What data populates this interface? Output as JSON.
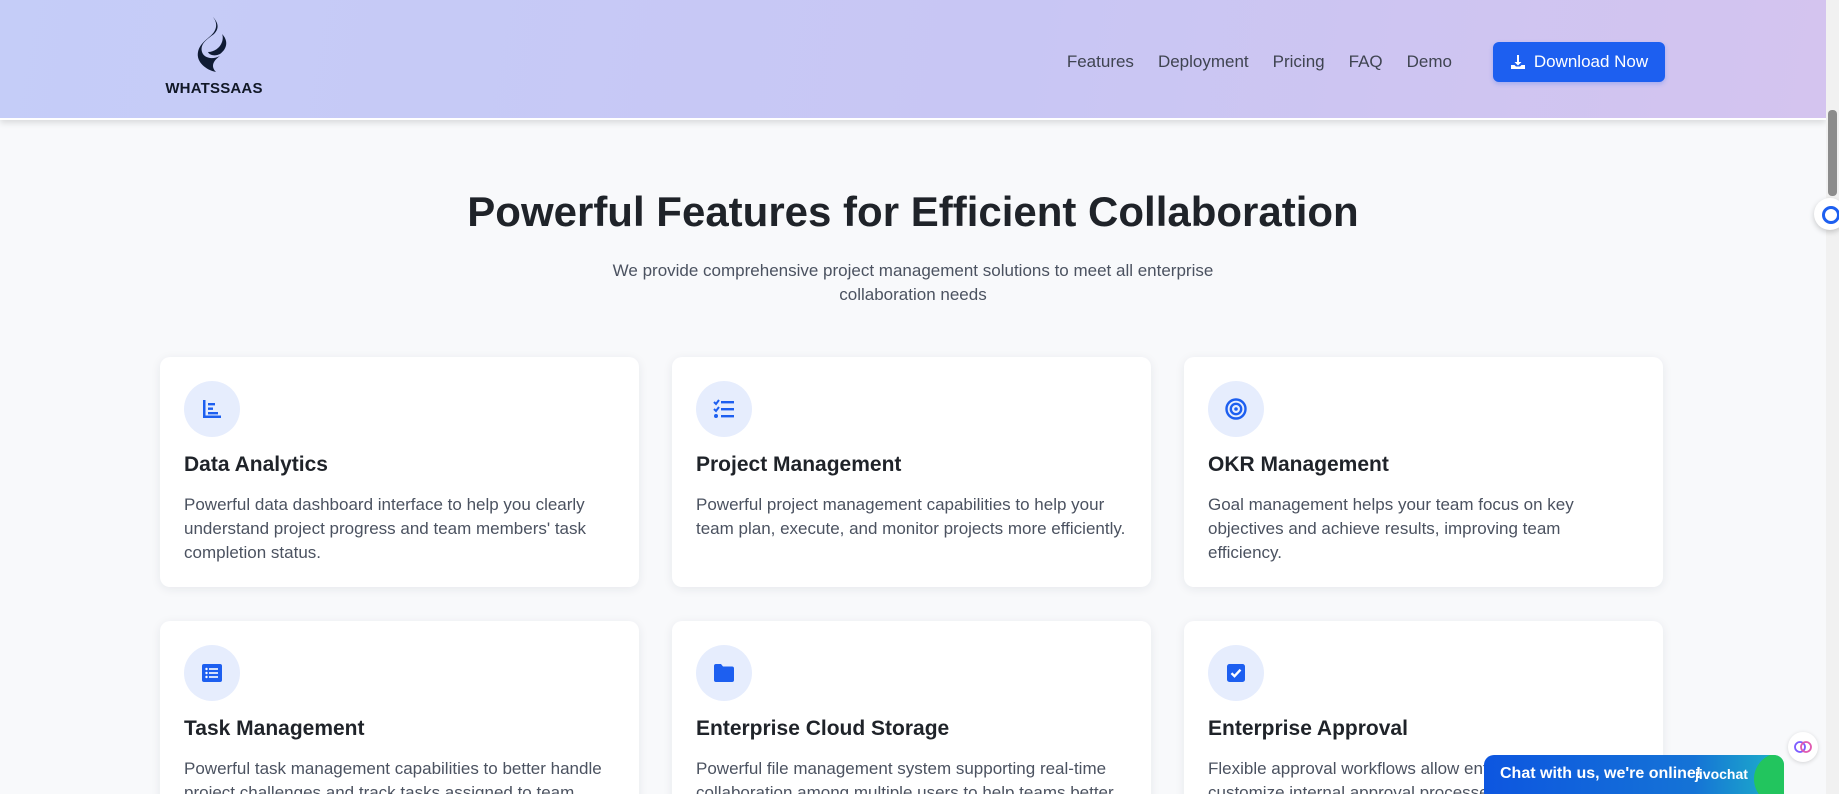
{
  "header": {
    "logo_text": "WHATSSAAS",
    "nav": [
      "Features",
      "Deployment",
      "Pricing",
      "FAQ",
      "Demo"
    ],
    "download_label": "Download Now"
  },
  "section": {
    "title": "Powerful Features for Efficient Collaboration",
    "subtitle": "We provide comprehensive project management solutions to meet all enterprise collaboration needs"
  },
  "features": [
    {
      "icon": "chart-icon",
      "title": "Data Analytics",
      "desc": "Powerful data dashboard interface to help you clearly understand project progress and team members' task completion status."
    },
    {
      "icon": "checklist-icon",
      "title": "Project Management",
      "desc": "Powerful project management capabilities to help your team plan, execute, and monitor projects more efficiently."
    },
    {
      "icon": "target-icon",
      "title": "OKR Management",
      "desc": "Goal management helps your team focus on key objectives and achieve results, improving team efficiency."
    },
    {
      "icon": "list-icon",
      "title": "Task Management",
      "desc": "Powerful task management capabilities to better handle project challenges and track tasks assigned to team"
    },
    {
      "icon": "folder-icon",
      "title": "Enterprise Cloud Storage",
      "desc": "Powerful file management system supporting real-time collaboration among multiple users to help teams better"
    },
    {
      "icon": "checkbox-icon",
      "title": "Enterprise Approval",
      "desc": "Flexible approval workflows allow enterprises to customize internal approval processes"
    }
  ],
  "chat": {
    "label": "Chat with us, we're online!",
    "brand": "jivochat"
  },
  "colors": {
    "accent": "#1d5ff0",
    "icon_bg": "#e6edfd",
    "header_gradient_start": "#c5cdf8",
    "header_gradient_end": "#d4c4ef"
  }
}
